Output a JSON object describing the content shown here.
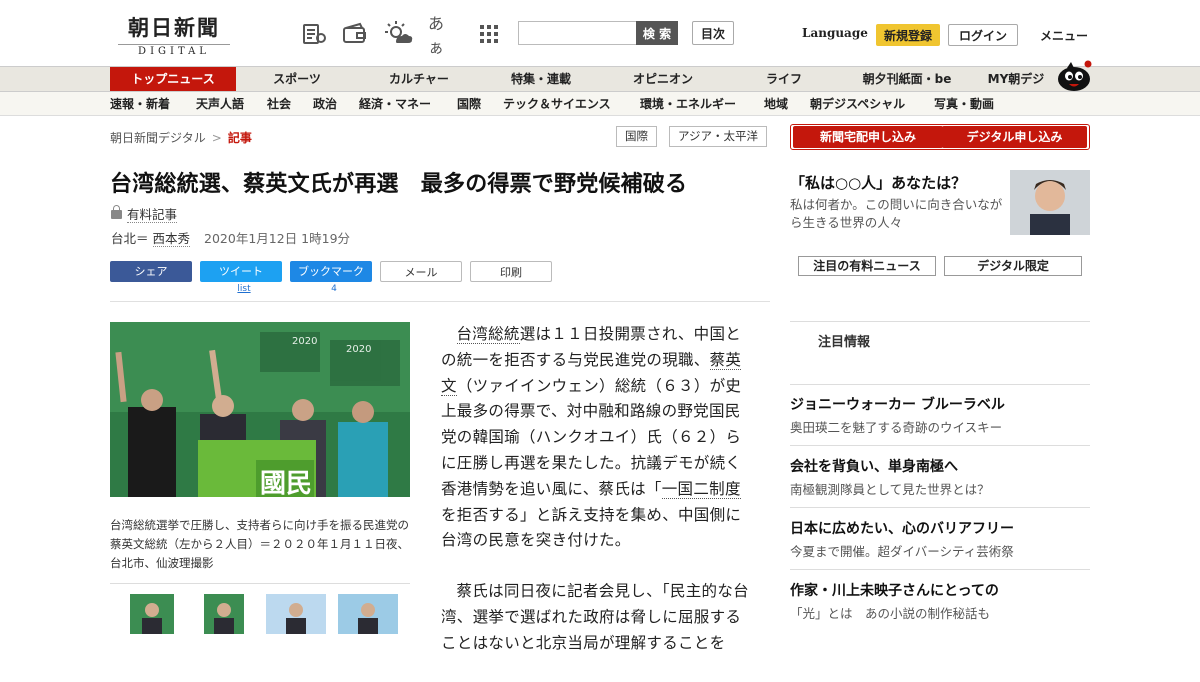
{
  "header": {
    "logo_main": "朝日新聞",
    "logo_sub": "DIGITAL",
    "icons": [
      "newspaper-icon",
      "wallet-icon",
      "weather-icon",
      "font-size-icon",
      "grid-icon"
    ],
    "font_label": "あぁ",
    "search_button": "検 索",
    "mokuji_button": "目次",
    "language_label": "Language",
    "register_button": "新規登録",
    "login_button": "ログイン",
    "menu_label": "メニュー"
  },
  "nav_primary": [
    {
      "label": "トップニュース",
      "active": true
    },
    {
      "label": "スポーツ"
    },
    {
      "label": "カルチャー"
    },
    {
      "label": "特集・連載"
    },
    {
      "label": "オピニオン"
    },
    {
      "label": "ライフ"
    },
    {
      "label": "朝夕刊紙面・be"
    },
    {
      "label": "MY朝デジ"
    }
  ],
  "nav_secondary": [
    "速報・新着",
    "天声人語",
    "社会",
    "政治",
    "経済・マネー",
    "国際",
    "テック＆サイエンス",
    "環境・エネルギー",
    "地域",
    "朝デジスペシャル",
    "写真・動画"
  ],
  "breadcrumb": {
    "home": "朝日新聞デジタル",
    "sep": ">",
    "current": "記事"
  },
  "tags": [
    "国際",
    "アジア・太平洋"
  ],
  "article": {
    "headline": "台湾総統選、蔡英文氏が再選　最多の得票で野党候補破る",
    "paid_label": "有料記事",
    "location": "台北＝",
    "author": "西本秀",
    "date": "2020年1月12日 1時19分",
    "p1_kw1": "台湾総統",
    "p1_a": "選は１１日投開票され、中国との統一を拒否する与党民進党の現職、",
    "p1_kw2": "蔡英文",
    "p1_b": "（ツァイインウェン）総統（６３）が史上最多の得票で、対中融和路線の野党国民党の韓国瑜（ハンクオユイ）氏（６２）らに圧勝し再選を果たした。抗議デモが続く香港情勢を追い風に、蔡氏は「",
    "p1_kw3": "一国二制度",
    "p1_c": "を拒否する」と訴え支持を集め、中国側に台湾の民意を突き付けた。",
    "p2": "蔡氏は同日夜に記者会見し、「民主的な台湾、選挙で選ばれた政府は脅しに屈服することはないと北京当局が理解することを",
    "photo_caption": "台湾総統選挙で圧勝し、支持者らに向け手を振る民進党の蔡英文総統（左から２人目）＝２０２０年１月１１日夜、台北市、仙波理撮影"
  },
  "share": {
    "facebook": "シェア",
    "twitter": "ツイート",
    "twitter_count": "list",
    "bookmark": "ブックマーク",
    "bookmark_count": "4",
    "mail": "メール",
    "print": "印刷"
  },
  "sidebar": {
    "btn_paper": "新聞宅配申し込み",
    "btn_digital": "デジタル申し込み",
    "promo_title": "「私は○○人」あなたは？",
    "promo_sub": "私は何者か。この問いに向き合いながら生きる世界の人々",
    "tab_news": "注目の有料ニュース",
    "tab_limited": "デジタル限定",
    "section_heading": "注目情報",
    "items": [
      {
        "title": "ジョニーウォーカー ブルーラベル",
        "sub": "奥田瑛二を魅了する奇跡のウイスキー"
      },
      {
        "title": "会社を背負い、単身南極へ",
        "sub": "南極観測隊員として見た世界とは？"
      },
      {
        "title": "日本に広めたい、心のバリアフリー",
        "sub": "今夏まで開催。超ダイバーシティ芸術祭"
      },
      {
        "title": "作家・川上未映子さんにとっての",
        "sub": "「光」とは　あの小説の制作秘話も"
      }
    ]
  },
  "colors": {
    "accent": "#c4170c",
    "register": "#f0c530",
    "facebook": "#3b5998",
    "twitter": "#1da1f2"
  }
}
